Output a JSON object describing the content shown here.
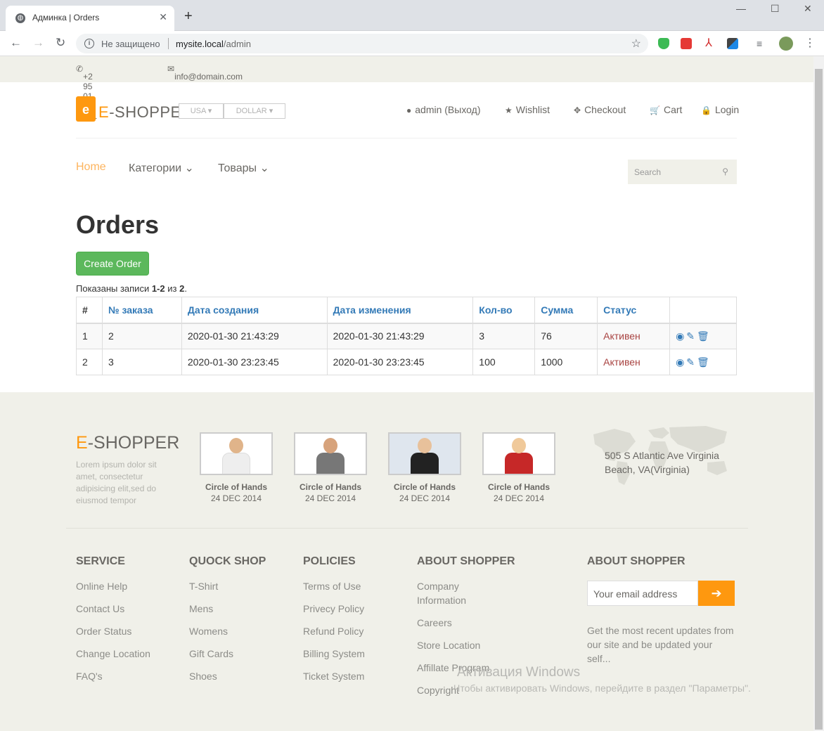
{
  "browser": {
    "tab_title": "Админка | Orders",
    "new_tab": "+",
    "insecure_label": "Не защищено",
    "url_host": "mysite.local",
    "url_path": "/admin"
  },
  "topbar": {
    "phone": "+2 95 01 88 821",
    "email": "info@domain.com"
  },
  "header": {
    "logo_e": "E",
    "logo_rest": "-SHOPPER",
    "country": "USA",
    "currency": "DOLLAR",
    "user_menu": [
      "admin (Выход)",
      "Wishlist",
      "Checkout",
      "Cart",
      "Login"
    ]
  },
  "nav": {
    "home": "Home",
    "categories": "Категории",
    "products": "Товары",
    "search_placeholder": "Search"
  },
  "main": {
    "title": "Orders",
    "create_button": "Create Order",
    "summary_prefix": "Показаны записи ",
    "summary_range": "1-2",
    "summary_mid": " из ",
    "summary_total": "2",
    "summary_end": ".",
    "columns": [
      "#",
      "№ заказа",
      "Дата создания",
      "Дата изменения",
      "Кол-во",
      "Сумма",
      "Статус"
    ],
    "rows": [
      {
        "n": "1",
        "order": "2",
        "created": "2020-01-30 21:43:29",
        "updated": "2020-01-30 21:43:29",
        "qty": "3",
        "sum": "76",
        "status": "Активен"
      },
      {
        "n": "2",
        "order": "3",
        "created": "2020-01-30 23:23:45",
        "updated": "2020-01-30 23:23:45",
        "qty": "100",
        "sum": "1000",
        "status": "Активен"
      }
    ]
  },
  "footer": {
    "logo_e": "E",
    "logo_rest": "-SHOPPER",
    "lorem": "Lorem ipsum dolor sit amet, consectetur adipisicing elit,sed do eiusmod tempor",
    "videos": [
      {
        "caption": "Circle of Hands",
        "date": "24 DEC 2014"
      },
      {
        "caption": "Circle of Hands",
        "date": "24 DEC 2014"
      },
      {
        "caption": "Circle of Hands",
        "date": "24 DEC 2014"
      },
      {
        "caption": "Circle of Hands",
        "date": "24 DEC 2014"
      }
    ],
    "address": "505 S Atlantic Ave Virginia Beach, VA(Virginia)",
    "service": {
      "title": "SERVICE",
      "links": [
        "Online Help",
        "Contact Us",
        "Order Status",
        "Change Location",
        "FAQ's"
      ]
    },
    "quickshop": {
      "title": "QUOCK SHOP",
      "links": [
        "T-Shirt",
        "Mens",
        "Womens",
        "Gift Cards",
        "Shoes"
      ]
    },
    "policies": {
      "title": "POLICIES",
      "links": [
        "Terms of Use",
        "Privecy Policy",
        "Refund Policy",
        "Billing System",
        "Ticket System"
      ]
    },
    "about": {
      "title": "ABOUT SHOPPER",
      "links": [
        "Company Information",
        "Careers",
        "Store Location",
        "Affillate Program",
        "Copyright"
      ]
    },
    "subscribe": {
      "title": "ABOUT SHOPPER",
      "placeholder": "Your email address",
      "text": "Get the most recent updates from our site and be updated your self..."
    }
  },
  "watermark": {
    "line1": "Активация Windows",
    "line2": "Чтобы активировать Windows, перейдите в раздел \"Параметры\"."
  },
  "colors": {
    "accent": "#fe980f",
    "link": "#337ab7",
    "status": "#a94442",
    "create_button": "#5cb85c"
  }
}
